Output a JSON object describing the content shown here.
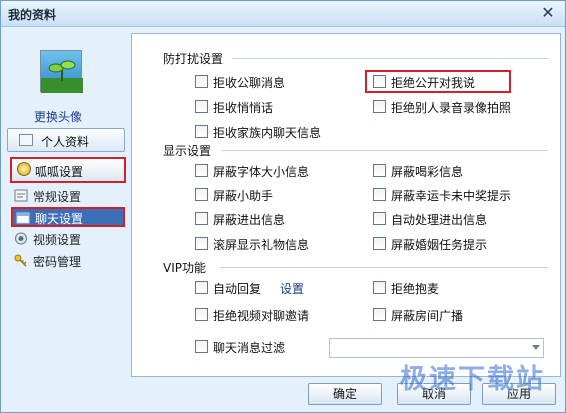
{
  "window": {
    "title": "我的资料"
  },
  "sidebar": {
    "change_avatar": "更换头像",
    "profile_button": "个人资料",
    "section_title": "呱呱设置",
    "items": [
      {
        "label": "常规设置",
        "icon": "gear-settings-icon"
      },
      {
        "label": "聊天设置",
        "icon": "chat-window-icon"
      },
      {
        "label": "视频设置",
        "icon": "video-camera-icon"
      },
      {
        "label": "密码管理",
        "icon": "key-icon"
      }
    ]
  },
  "groups": {
    "antidisturb": {
      "title": "防打扰设置",
      "options": [
        {
          "label": "拒收公聊消息",
          "checked": false
        },
        {
          "label": "拒绝公开对我说",
          "checked": false
        },
        {
          "label": "拒收悄悄话",
          "checked": false
        },
        {
          "label": "拒绝别人录音录像拍照",
          "checked": false
        },
        {
          "label": "拒收家族内聊天信息",
          "checked": false
        }
      ]
    },
    "display": {
      "title": "显示设置",
      "options": [
        {
          "label": "屏蔽字体大小信息",
          "checked": false
        },
        {
          "label": "屏蔽喝彩信息",
          "checked": false
        },
        {
          "label": "屏蔽小助手",
          "checked": false
        },
        {
          "label": "屏蔽幸运卡未中奖提示",
          "checked": false
        },
        {
          "label": "屏蔽进出信息",
          "checked": false
        },
        {
          "label": "自动处理进出信息",
          "checked": false
        },
        {
          "label": "滚屏显示礼物信息",
          "checked": false
        },
        {
          "label": "屏蔽婚姻任务提示",
          "checked": false
        }
      ]
    },
    "vip": {
      "title": "VIP功能",
      "options": [
        {
          "label": "自动回复",
          "checked": false
        },
        {
          "label": "拒绝抱麦",
          "checked": false
        },
        {
          "label": "拒绝视频对聊邀请",
          "checked": false
        },
        {
          "label": "屏蔽房间广播",
          "checked": false
        },
        {
          "label": "聊天消息过滤",
          "checked": false
        }
      ],
      "settings_link": "设置",
      "filter_select_value": ""
    }
  },
  "buttons": {
    "ok": "确定",
    "cancel": "取消",
    "apply": "应用"
  },
  "watermark": "极速下载站",
  "colors": {
    "highlight_red": "#d4202a",
    "selected_nav": "#3d6fb8",
    "link_blue": "#1a3f8a"
  }
}
